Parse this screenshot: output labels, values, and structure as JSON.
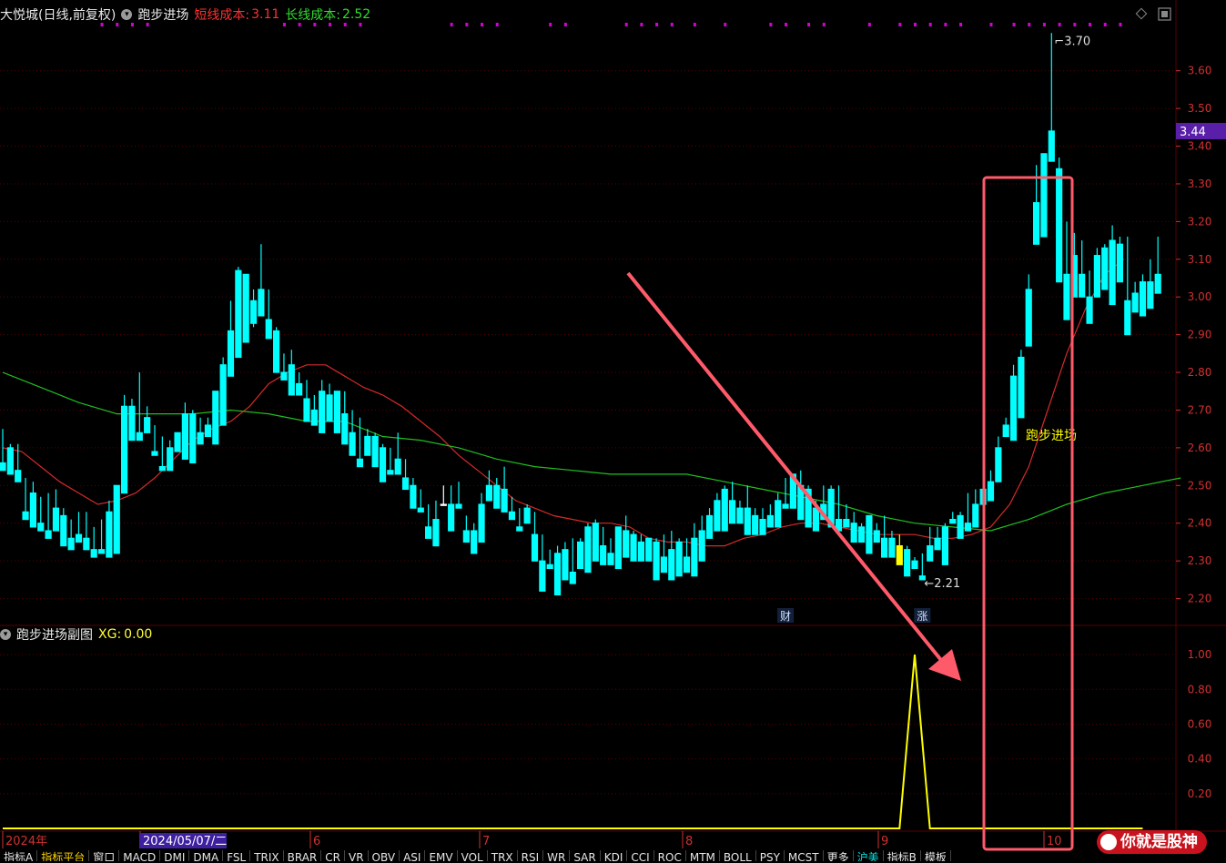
{
  "header": {
    "stock_name": "大悦城(日线,前复权)",
    "indicator_name": "跑步进场",
    "short_cost_label": "短线成本:",
    "short_cost_value": "3.11",
    "long_cost_label": "长线成本:",
    "long_cost_value": "2.52"
  },
  "sub_header": {
    "title": "跑步进场副图",
    "xg_label": "XG:",
    "xg_value": "0.00"
  },
  "colors": {
    "up": "#ff4d4d",
    "down": "#00ffff",
    "flat": "#ffffff",
    "signal": "#ffff00",
    "ma_short": "#d42a2a",
    "ma_long": "#1fbf1f",
    "grid": "#5a0000",
    "axis_text": "#d03030",
    "box": "#ff5a6a",
    "arrow": "#ff5a6a",
    "dot": "#d400d4"
  },
  "tabs": [
    "指标A",
    "指标平台",
    "窗口",
    "MACD",
    "DMI",
    "DMA",
    "FSL",
    "TRIX",
    "BRAR",
    "CR",
    "VR",
    "OBV",
    "ASI",
    "EMV",
    "VOL",
    "TRX",
    "RSI",
    "WR",
    "SAR",
    "KDJ",
    "CCI",
    "ROC",
    "MTM",
    "BOLL",
    "PSY",
    "MCST",
    "更多",
    "沪美",
    "指标B",
    "模板"
  ],
  "watermark": "你就是股神",
  "chart_data": [
    {
      "type": "candlestick",
      "y_ticks": [
        2.2,
        2.3,
        2.4,
        2.5,
        2.6,
        2.7,
        2.8,
        2.9,
        3.0,
        3.1,
        3.2,
        3.3,
        3.4,
        3.5,
        3.6
      ],
      "ylim": [
        2.17,
        3.72
      ],
      "current_price": "3.44",
      "high_label": "3.70",
      "low_label": "2.21",
      "annotation": "跑步进场",
      "markers": [
        {
          "label": "财",
          "index": 103
        },
        {
          "label": "涨",
          "index": 121
        }
      ],
      "x_labels": [
        "2024年",
        "2024/05/07/二",
        "6",
        "7",
        "8",
        "9",
        "10"
      ],
      "ohlc": [
        [
          2.56,
          2.65,
          2.56,
          2.54
        ],
        [
          2.6,
          2.61,
          2.55,
          2.53
        ],
        [
          2.54,
          2.61,
          2.54,
          2.51
        ],
        [
          2.43,
          2.52,
          2.43,
          2.41
        ],
        [
          2.48,
          2.51,
          2.48,
          2.39
        ],
        [
          2.4,
          2.47,
          2.4,
          2.38
        ],
        [
          2.38,
          2.48,
          2.38,
          2.36
        ],
        [
          2.44,
          2.49,
          2.44,
          2.38
        ],
        [
          2.42,
          2.44,
          2.42,
          2.34
        ],
        [
          2.36,
          2.41,
          2.36,
          2.33
        ],
        [
          2.37,
          2.43,
          2.37,
          2.35
        ],
        [
          2.36,
          2.43,
          2.36,
          2.33
        ],
        [
          2.33,
          2.39,
          2.33,
          2.31
        ],
        [
          2.33,
          2.41,
          2.33,
          2.32
        ],
        [
          2.43,
          2.46,
          2.43,
          2.31
        ],
        [
          2.5,
          2.5,
          2.49,
          2.32
        ],
        [
          2.71,
          2.74,
          2.71,
          2.48
        ],
        [
          2.71,
          2.73,
          2.65,
          2.62
        ],
        [
          2.64,
          2.8,
          2.64,
          2.62
        ],
        [
          2.68,
          2.71,
          2.64,
          2.64
        ],
        [
          2.59,
          2.66,
          2.59,
          2.58
        ],
        [
          2.55,
          2.63,
          2.55,
          2.54
        ],
        [
          2.6,
          2.62,
          2.55,
          2.54
        ],
        [
          2.64,
          2.64,
          2.59,
          2.59
        ],
        [
          2.69,
          2.72,
          2.69,
          2.57
        ],
        [
          2.69,
          2.7,
          2.61,
          2.56
        ],
        [
          2.64,
          2.68,
          2.63,
          2.61
        ],
        [
          2.66,
          2.68,
          2.66,
          2.63
        ],
        [
          2.75,
          2.75,
          2.67,
          2.61
        ],
        [
          2.82,
          2.84,
          2.75,
          2.66
        ],
        [
          2.91,
          2.99,
          2.83,
          2.79
        ],
        [
          3.07,
          3.08,
          2.9,
          2.84
        ],
        [
          3.06,
          3.06,
          2.9,
          2.88
        ],
        [
          2.99,
          3.02,
          2.92,
          2.93
        ],
        [
          3.02,
          3.14,
          2.95,
          2.95
        ],
        [
          2.94,
          3.02,
          2.9,
          2.89
        ],
        [
          2.91,
          2.92,
          2.8,
          2.8
        ],
        [
          2.8,
          2.85,
          2.8,
          2.78
        ],
        [
          2.82,
          2.86,
          2.78,
          2.74
        ],
        [
          2.77,
          2.8,
          2.76,
          2.74
        ],
        [
          2.73,
          2.78,
          2.73,
          2.67
        ],
        [
          2.7,
          2.74,
          2.69,
          2.66
        ],
        [
          2.75,
          2.78,
          2.75,
          2.64
        ],
        [
          2.74,
          2.77,
          2.69,
          2.67
        ],
        [
          2.75,
          2.75,
          2.65,
          2.64
        ],
        [
          2.69,
          2.75,
          2.69,
          2.61
        ],
        [
          2.64,
          2.7,
          2.63,
          2.58
        ],
        [
          2.57,
          2.68,
          2.55,
          2.55
        ],
        [
          2.63,
          2.65,
          2.59,
          2.58
        ],
        [
          2.63,
          2.64,
          2.56,
          2.55
        ],
        [
          2.6,
          2.61,
          2.53,
          2.51
        ],
        [
          2.54,
          2.6,
          2.54,
          2.53
        ],
        [
          2.57,
          2.64,
          2.57,
          2.53
        ],
        [
          2.52,
          2.57,
          2.49,
          2.49
        ],
        [
          2.5,
          2.52,
          2.45,
          2.44
        ],
        [
          2.44,
          2.49,
          2.44,
          2.43
        ],
        [
          2.39,
          2.45,
          2.38,
          2.36
        ],
        [
          2.41,
          2.46,
          2.41,
          2.34
        ],
        [
          2.45,
          2.5,
          2.45,
          2.45
        ],
        [
          2.45,
          2.5,
          2.38,
          2.38
        ],
        [
          2.45,
          2.51,
          2.45,
          2.44
        ],
        [
          2.38,
          2.42,
          2.38,
          2.35
        ],
        [
          2.38,
          2.4,
          2.37,
          2.32
        ],
        [
          2.45,
          2.48,
          2.45,
          2.35
        ],
        [
          2.5,
          2.54,
          2.49,
          2.46
        ],
        [
          2.5,
          2.52,
          2.44,
          2.44
        ],
        [
          2.49,
          2.55,
          2.49,
          2.43
        ],
        [
          2.43,
          2.47,
          2.43,
          2.41
        ],
        [
          2.39,
          2.44,
          2.38,
          2.38
        ],
        [
          2.44,
          2.45,
          2.4,
          2.4
        ],
        [
          2.37,
          2.43,
          2.35,
          2.3
        ],
        [
          2.3,
          2.37,
          2.29,
          2.22
        ],
        [
          2.29,
          2.33,
          2.29,
          2.28
        ],
        [
          2.32,
          2.34,
          2.32,
          2.21
        ],
        [
          2.33,
          2.35,
          2.29,
          2.25
        ],
        [
          2.27,
          2.36,
          2.27,
          2.24
        ],
        [
          2.35,
          2.36,
          2.32,
          2.28
        ],
        [
          2.39,
          2.4,
          2.32,
          2.27
        ],
        [
          2.4,
          2.41,
          2.31,
          2.3
        ],
        [
          2.34,
          2.39,
          2.33,
          2.29
        ],
        [
          2.32,
          2.36,
          2.32,
          2.29
        ],
        [
          2.39,
          2.39,
          2.29,
          2.28
        ],
        [
          2.38,
          2.42,
          2.38,
          2.31
        ],
        [
          2.37,
          2.38,
          2.34,
          2.3
        ],
        [
          2.35,
          2.37,
          2.31,
          2.3
        ],
        [
          2.36,
          2.36,
          2.3,
          2.3
        ],
        [
          2.35,
          2.36,
          2.34,
          2.25
        ],
        [
          2.31,
          2.37,
          2.31,
          2.27
        ],
        [
          2.33,
          2.38,
          2.29,
          2.25
        ],
        [
          2.35,
          2.36,
          2.34,
          2.26
        ],
        [
          2.31,
          2.36,
          2.31,
          2.27
        ],
        [
          2.36,
          2.4,
          2.35,
          2.26
        ],
        [
          2.38,
          2.42,
          2.31,
          2.3
        ],
        [
          2.42,
          2.44,
          2.38,
          2.36
        ],
        [
          2.46,
          2.48,
          2.38,
          2.38
        ],
        [
          2.49,
          2.5,
          2.41,
          2.38
        ],
        [
          2.46,
          2.51,
          2.45,
          2.4
        ],
        [
          2.44,
          2.46,
          2.41,
          2.4
        ],
        [
          2.44,
          2.5,
          2.44,
          2.37
        ],
        [
          2.42,
          2.44,
          2.38,
          2.37
        ],
        [
          2.41,
          2.44,
          2.38,
          2.37
        ],
        [
          2.42,
          2.45,
          2.4,
          2.39
        ],
        [
          2.46,
          2.48,
          2.45,
          2.39
        ],
        [
          2.45,
          2.52,
          2.45,
          2.44
        ],
        [
          2.53,
          2.53,
          2.46,
          2.44
        ],
        [
          2.5,
          2.54,
          2.48,
          2.41
        ],
        [
          2.49,
          2.5,
          2.4,
          2.39
        ],
        [
          2.44,
          2.46,
          2.4,
          2.38
        ],
        [
          2.45,
          2.5,
          2.43,
          2.41
        ],
        [
          2.49,
          2.5,
          2.4,
          2.39
        ],
        [
          2.41,
          2.5,
          2.41,
          2.38
        ],
        [
          2.41,
          2.45,
          2.41,
          2.39
        ],
        [
          2.4,
          2.43,
          2.38,
          2.35
        ],
        [
          2.39,
          2.4,
          2.37,
          2.35
        ],
        [
          2.42,
          2.42,
          2.37,
          2.32
        ],
        [
          2.38,
          2.4,
          2.36,
          2.35
        ],
        [
          2.36,
          2.42,
          2.36,
          2.31
        ],
        [
          2.36,
          2.38,
          2.32,
          2.31
        ],
        [
          2.34,
          2.37,
          2.34,
          2.29
        ],
        [
          2.33,
          2.34,
          2.3,
          2.26
        ],
        [
          2.3,
          2.31,
          2.29,
          2.28
        ],
        [
          2.26,
          2.32,
          2.25,
          2.25
        ],
        [
          2.34,
          2.39,
          2.34,
          2.3
        ],
        [
          2.36,
          2.39,
          2.34,
          2.33
        ],
        [
          2.39,
          2.4,
          2.36,
          2.29
        ],
        [
          2.41,
          2.43,
          2.41,
          2.4
        ],
        [
          2.42,
          2.43,
          2.37,
          2.36
        ],
        [
          2.4,
          2.48,
          2.4,
          2.38
        ],
        [
          2.45,
          2.49,
          2.4,
          2.39
        ],
        [
          2.49,
          2.55,
          2.48,
          2.45
        ],
        [
          2.51,
          2.54,
          2.47,
          2.46
        ],
        [
          2.6,
          2.63,
          2.52,
          2.51
        ],
        [
          2.66,
          2.68,
          2.63,
          2.63
        ],
        [
          2.79,
          2.82,
          2.63,
          2.62
        ],
        [
          2.84,
          2.86,
          2.7,
          2.68
        ],
        [
          3.02,
          3.06,
          2.93,
          2.87
        ],
        [
          3.25,
          3.35,
          3.24,
          3.14
        ],
        [
          3.38,
          3.38,
          3.26,
          3.16
        ],
        [
          3.44,
          3.7,
          3.41,
          3.36
        ],
        [
          3.34,
          3.37,
          3.06,
          3.04
        ],
        [
          3.06,
          3.2,
          3.0,
          2.94
        ],
        [
          3.11,
          3.17,
          3.03,
          3.0
        ],
        [
          3.06,
          3.15,
          3.06,
          3.0
        ],
        [
          3.0,
          3.07,
          2.99,
          2.93
        ],
        [
          3.11,
          3.13,
          3.1,
          3.0
        ],
        [
          3.13,
          3.14,
          3.03,
          3.02
        ],
        [
          3.15,
          3.19,
          3.0,
          2.98
        ],
        [
          3.14,
          3.16,
          3.04,
          3.04
        ],
        [
          2.99,
          3.16,
          2.97,
          2.9
        ],
        [
          3.01,
          3.04,
          2.99,
          2.96
        ],
        [
          3.04,
          3.06,
          2.97,
          2.95
        ],
        [
          3.04,
          3.1,
          3.04,
          2.97
        ],
        [
          3.06,
          3.16,
          3.06,
          3.01
        ]
      ],
      "ma_short": [
        2.6,
        2.59,
        2.55,
        2.51,
        2.48,
        2.45,
        2.46,
        2.48,
        2.52,
        2.57,
        2.62,
        2.65,
        2.67,
        2.71,
        2.77,
        2.8,
        2.82,
        2.82,
        2.79,
        2.76,
        2.74,
        2.71,
        2.67,
        2.63,
        2.58,
        2.54,
        2.5,
        2.46,
        2.44,
        2.42,
        2.41,
        2.4,
        2.4,
        2.39,
        2.36,
        2.35,
        2.35,
        2.34,
        2.34,
        2.36,
        2.37,
        2.39,
        2.4,
        2.4,
        2.39,
        2.38,
        2.37,
        2.37,
        2.37,
        2.36,
        2.36,
        2.37,
        2.39,
        2.45,
        2.55,
        2.7,
        2.85,
        2.97,
        3.06,
        3.1
      ],
      "ma_long": [
        2.8,
        2.76,
        2.72,
        2.69,
        2.69,
        2.69,
        2.7,
        2.69,
        2.67,
        2.67,
        2.63,
        2.62,
        2.6,
        2.57,
        2.55,
        2.54,
        2.53,
        2.53,
        2.53,
        2.51,
        2.49,
        2.47,
        2.45,
        2.42,
        2.4,
        2.39,
        2.38,
        2.41,
        2.45,
        2.48,
        2.5,
        2.52
      ]
    },
    {
      "type": "line",
      "y_ticks": [
        0.2,
        0.4,
        0.6,
        0.8,
        1.0
      ],
      "ylim": [
        0,
        1.1
      ],
      "series": [
        {
          "name": "XG",
          "points": [
            [
              0,
              0
            ],
            [
              118,
              0
            ],
            [
              119,
              0.5
            ],
            [
              120,
              1.0
            ],
            [
              121,
              0.5
            ],
            [
              122,
              0
            ],
            [
              150,
              0
            ]
          ]
        }
      ]
    }
  ]
}
